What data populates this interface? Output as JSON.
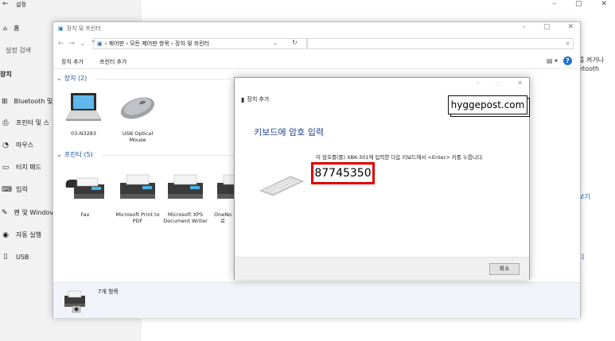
{
  "settings": {
    "title": "설정",
    "home": "홈",
    "search_placeholder": "설정 검색",
    "section": "장치",
    "nav": [
      {
        "label": "Bluetooth 및",
        "icon": "bluetooth-icon"
      },
      {
        "label": "프린터 및 스",
        "icon": "printer-icon"
      },
      {
        "label": "마우스",
        "icon": "mouse-icon"
      },
      {
        "label": "터치 패드",
        "icon": "touchpad-icon"
      },
      {
        "label": "입력",
        "icon": "keyboard-icon"
      },
      {
        "label": "펜 및 Windov",
        "icon": "pen-icon"
      },
      {
        "label": "자동 실행",
        "icon": "autoplay-icon"
      },
      {
        "label": "USB",
        "icon": "usb-icon"
      }
    ],
    "right_fragments": {
      "line1": "를 켜거나",
      "line2": "etooth",
      "link1": "보기",
      "link2": "디"
    }
  },
  "control_panel": {
    "title": "장치 및 프린터",
    "address": [
      "제어판",
      "모든 제어판 항목",
      "장치 및 프린터"
    ],
    "commands": [
      "장치 추가",
      "프린터 추가"
    ],
    "groups": [
      {
        "label": "장치 (2)",
        "devices": [
          "03-N3283",
          "USB Optical Mouse"
        ]
      },
      {
        "label": "프린터 (5)",
        "devices": [
          "Fax",
          "Microsoft Print to PDF",
          "Microsoft XPS Document Writer",
          "OneNo 로"
        ]
      }
    ],
    "status_count": "7개 항목"
  },
  "dialog": {
    "title": "장치 추가",
    "heading": "키보드에 암호 입력",
    "instruction": "이 암호를(를) XBK-301에 입력한 다음 키보드에서 <Enter> 키를 누릅니다.",
    "code": "87745350",
    "cancel": "취소",
    "watermark": "hyggepost.com"
  },
  "colors": {
    "heading": "#1f3f8f",
    "highlight": "#e00000",
    "accent": "#1f6fd1"
  }
}
